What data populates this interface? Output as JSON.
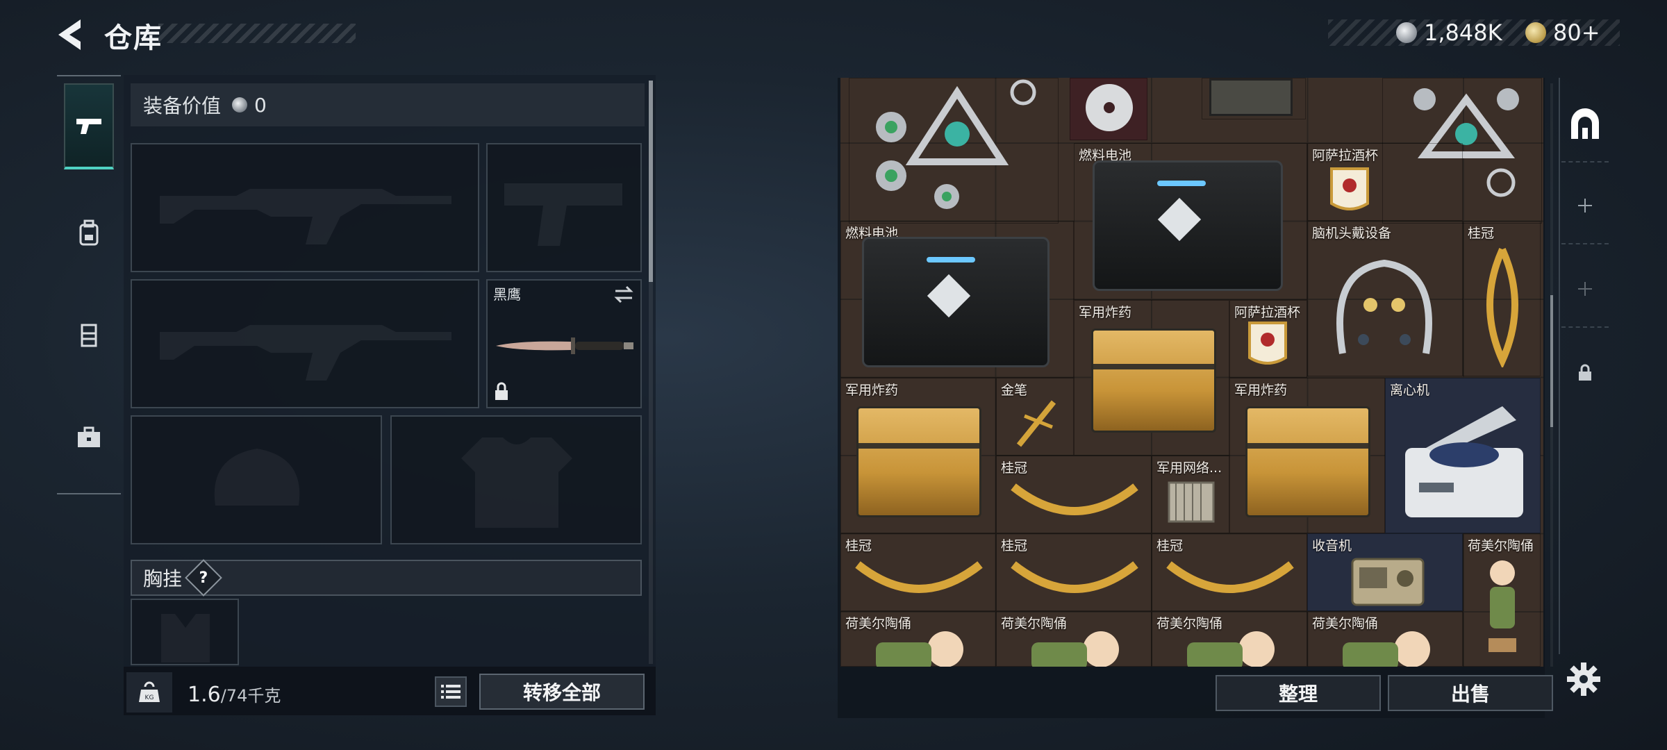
{
  "header": {
    "title": "仓库",
    "currency_silver": "1,848K",
    "currency_gold": "80+"
  },
  "tabs": [
    {
      "name": "weapons",
      "icon": "pistol-icon",
      "active": true
    },
    {
      "name": "backpack",
      "icon": "backpack-icon",
      "active": false
    },
    {
      "name": "vest",
      "icon": "vest-icon",
      "active": false
    },
    {
      "name": "briefcase",
      "icon": "briefcase-icon",
      "active": false
    }
  ],
  "equipment": {
    "value_label": "装备价值",
    "value": "0",
    "knife_slot_label": "黑鹰",
    "chest_rig_label": "胸挂",
    "help_glyph": "?"
  },
  "bottom_left": {
    "weight_current": "1.6",
    "weight_max": "/74千克",
    "transfer_all": "转移全部"
  },
  "storage": {
    "items": [
      {
        "label": "燃料电池",
        "type": "battery"
      },
      {
        "label": "阿萨拉酒杯",
        "type": "cup"
      },
      {
        "label": "燃料电池",
        "type": "battery"
      },
      {
        "label": "脑机头戴设备",
        "type": "headset"
      },
      {
        "label": "桂冠",
        "type": "laurel"
      },
      {
        "label": "军用炸药",
        "type": "explosive"
      },
      {
        "label": "阿萨拉酒杯",
        "type": "cup"
      },
      {
        "label": "军用炸药",
        "type": "explosive"
      },
      {
        "label": "金笔",
        "type": "pen"
      },
      {
        "label": "军用炸药",
        "type": "explosive"
      },
      {
        "label": "离心机",
        "type": "centrifuge"
      },
      {
        "label": "桂冠",
        "type": "laurel"
      },
      {
        "label": "军用网络...",
        "type": "router"
      },
      {
        "label": "桂冠",
        "type": "laurel"
      },
      {
        "label": "桂冠",
        "type": "laurel"
      },
      {
        "label": "桂冠",
        "type": "laurel"
      },
      {
        "label": "收音机",
        "type": "radio"
      },
      {
        "label": "荷美尔陶俑",
        "type": "figurine"
      },
      {
        "label": "荷美尔陶俑",
        "type": "figurine"
      },
      {
        "label": "荷美尔陶俑",
        "type": "figurine"
      },
      {
        "label": "荷美尔陶俑",
        "type": "figurine"
      },
      {
        "label": "荷美尔陶俑",
        "type": "figurine"
      }
    ]
  },
  "actions": {
    "sort": "整理",
    "sell": "出售"
  },
  "colors": {
    "accent": "#4fd1c2",
    "grid_bg": "#3b2f28",
    "blue_cell": "#262d40",
    "red_cell": "#3e2124"
  }
}
